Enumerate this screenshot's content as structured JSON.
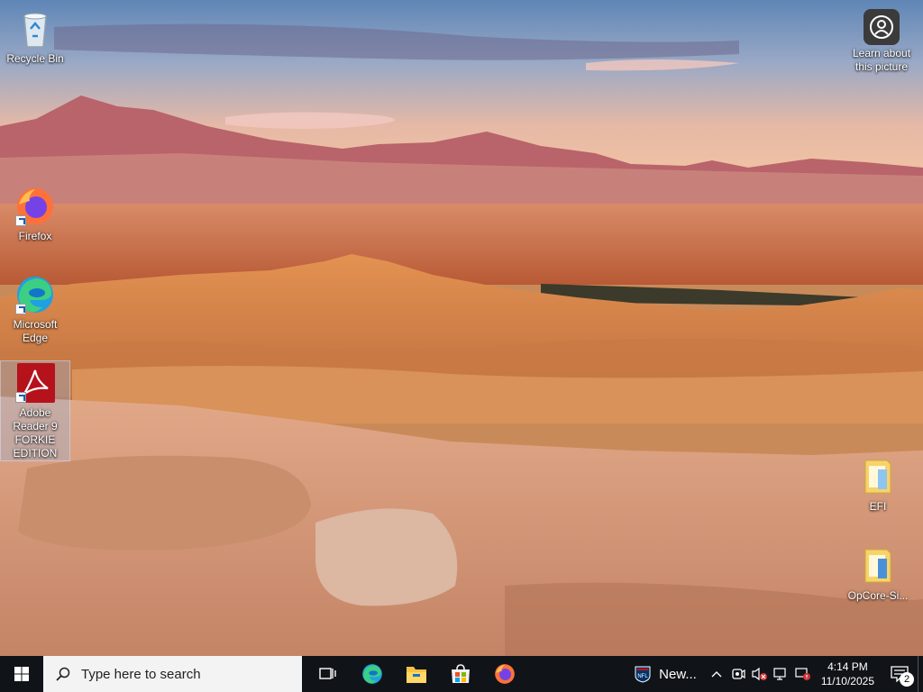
{
  "desktop": {
    "icons": [
      {
        "label": "Recycle Bin"
      },
      {
        "label": "Firefox"
      },
      {
        "label": "Microsoft Edge"
      },
      {
        "label": "Adobe Reader 9 FORKIE EDITION"
      },
      {
        "label": "EFI"
      },
      {
        "label": "OpCore-Si..."
      },
      {
        "label": "Learn about this picture"
      }
    ]
  },
  "taskbar": {
    "search_placeholder": "Type here to search",
    "news_label": "New...",
    "time": "4:14 PM",
    "date": "11/10/2025",
    "notification_count": "2",
    "pinned_apps": [
      "task-view-icon",
      "edge-icon",
      "file-explorer-icon",
      "store-icon",
      "firefox-icon"
    ],
    "accent_color": "#0078d4"
  }
}
